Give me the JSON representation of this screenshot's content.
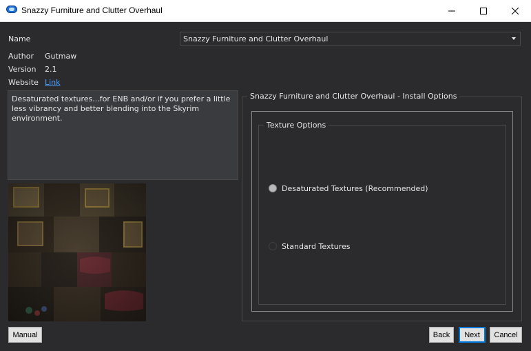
{
  "window": {
    "title": "Snazzy Furniture and Clutter Overhaul"
  },
  "info": {
    "name_label": "Name",
    "name_value": "Snazzy Furniture and Clutter Overhaul",
    "author_label": "Author",
    "author_value": "Gutmaw",
    "version_label": "Version",
    "version_value": "2.1",
    "website_label": "Website",
    "website_link": "Link"
  },
  "description": "Desaturated textures...for ENB and/or if you prefer a little less vibrancy and better blending into the Skyrim environment.",
  "install_options": {
    "title": "Snazzy Furniture and Clutter Overhaul - Install Options",
    "group_title": "Texture Options",
    "options": [
      {
        "label": "Desaturated Textures (Recommended)",
        "selected": true
      },
      {
        "label": "Standard Textures",
        "selected": false
      }
    ]
  },
  "buttons": {
    "manual": "Manual",
    "back": "Back",
    "next": "Next",
    "cancel": "Cancel"
  },
  "icons": {
    "app": "mod-organizer-icon",
    "minimize": "minimize-icon",
    "maximize": "maximize-icon",
    "close": "close-icon"
  },
  "colors": {
    "accent": "#0078d7",
    "link": "#4ea0ff",
    "background": "#2b2b2d"
  }
}
